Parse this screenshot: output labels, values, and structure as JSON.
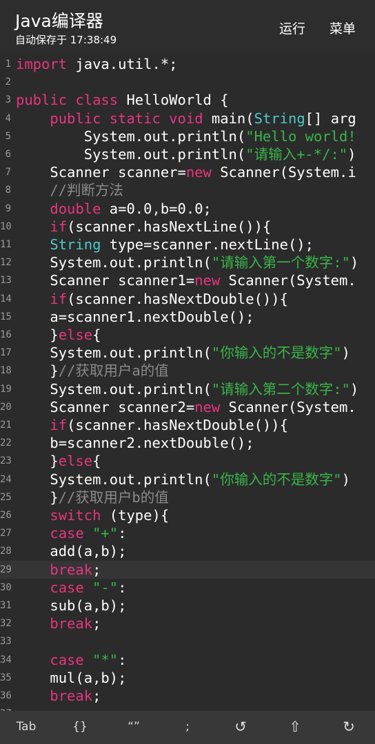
{
  "appbar": {
    "title": "Java编译器",
    "subtitle": "自动保存于 17:38:49",
    "run_label": "运行",
    "menu_label": "菜单"
  },
  "editor": {
    "current_line": 29,
    "colors": {
      "keyword": "#e9357f",
      "type": "#4dc9c9",
      "string": "#39b54a",
      "comment": "#8a8a8a",
      "text": "#ffffff"
    },
    "lines": [
      [
        {
          "t": "import",
          "c": "kw"
        },
        {
          "t": " java.util.*;"
        }
      ],
      [],
      [
        {
          "t": "public class",
          "c": "kw"
        },
        {
          "t": " HelloWorld {"
        }
      ],
      [
        {
          "t": "    "
        },
        {
          "t": "public static void",
          "c": "kw"
        },
        {
          "t": " main("
        },
        {
          "t": "String",
          "c": "ty"
        },
        {
          "t": "[] arg"
        }
      ],
      [
        {
          "t": "        System.out.println("
        },
        {
          "t": "\"Hello world!",
          "c": "st"
        }
      ],
      [
        {
          "t": "        System.out.println("
        },
        {
          "t": "\"请输入+-*/:\"",
          "c": "st"
        },
        {
          "t": ")"
        }
      ],
      [
        {
          "t": "    Scanner scanner="
        },
        {
          "t": "new",
          "c": "kw"
        },
        {
          "t": " Scanner(System.i"
        }
      ],
      [
        {
          "t": "    "
        },
        {
          "t": "//判断方法",
          "c": "cm"
        }
      ],
      [
        {
          "t": "    "
        },
        {
          "t": "double",
          "c": "kw"
        },
        {
          "t": " a=0.0,b=0.0;"
        }
      ],
      [
        {
          "t": "    "
        },
        {
          "t": "if",
          "c": "kw"
        },
        {
          "t": "(scanner.hasNextLine()){"
        }
      ],
      [
        {
          "t": "    "
        },
        {
          "t": "String",
          "c": "ty"
        },
        {
          "t": " type=scanner.nextLine();"
        }
      ],
      [
        {
          "t": "    System.out.println("
        },
        {
          "t": "\"请输入第一个数字:\"",
          "c": "st"
        },
        {
          "t": ")"
        }
      ],
      [
        {
          "t": "    Scanner scanner1="
        },
        {
          "t": "new",
          "c": "kw"
        },
        {
          "t": " Scanner(System."
        }
      ],
      [
        {
          "t": "    "
        },
        {
          "t": "if",
          "c": "kw"
        },
        {
          "t": "(scanner.hasNextDouble()){"
        }
      ],
      [
        {
          "t": "    a=scanner1.nextDouble();"
        }
      ],
      [
        {
          "t": "    }"
        },
        {
          "t": "else",
          "c": "kw"
        },
        {
          "t": "{"
        }
      ],
      [
        {
          "t": "    System.out.println("
        },
        {
          "t": "\"你输入的不是数字\"",
          "c": "st"
        },
        {
          "t": ")"
        }
      ],
      [
        {
          "t": "    }"
        },
        {
          "t": "//获取用户a的值",
          "c": "cm"
        }
      ],
      [
        {
          "t": "    System.out.println("
        },
        {
          "t": "\"请输入第二个数字:\"",
          "c": "st"
        },
        {
          "t": ")"
        }
      ],
      [
        {
          "t": "    Scanner scanner2="
        },
        {
          "t": "new",
          "c": "kw"
        },
        {
          "t": " Scanner(System."
        }
      ],
      [
        {
          "t": "    "
        },
        {
          "t": "if",
          "c": "kw"
        },
        {
          "t": "(scanner.hasNextDouble()){"
        }
      ],
      [
        {
          "t": "    b=scanner2.nextDouble();"
        }
      ],
      [
        {
          "t": "    }"
        },
        {
          "t": "else",
          "c": "kw"
        },
        {
          "t": "{"
        }
      ],
      [
        {
          "t": "    System.out.println("
        },
        {
          "t": "\"你输入的不是数字\"",
          "c": "st"
        },
        {
          "t": ")"
        }
      ],
      [
        {
          "t": "    }"
        },
        {
          "t": "//获取用户b的值",
          "c": "cm"
        }
      ],
      [
        {
          "t": "    "
        },
        {
          "t": "switch",
          "c": "kw"
        },
        {
          "t": " (type){"
        }
      ],
      [
        {
          "t": "    "
        },
        {
          "t": "case",
          "c": "kw"
        },
        {
          "t": " "
        },
        {
          "t": "\"+\"",
          "c": "st"
        },
        {
          "t": ":"
        }
      ],
      [
        {
          "t": "    add(a,b);"
        }
      ],
      [
        {
          "t": "    "
        },
        {
          "t": "break",
          "c": "kw"
        },
        {
          "t": ";"
        }
      ],
      [
        {
          "t": "    "
        },
        {
          "t": "case",
          "c": "kw"
        },
        {
          "t": " "
        },
        {
          "t": "\"-\"",
          "c": "st"
        },
        {
          "t": ":"
        }
      ],
      [
        {
          "t": "    sub(a,b);"
        }
      ],
      [
        {
          "t": "    "
        },
        {
          "t": "break",
          "c": "kw"
        },
        {
          "t": ";"
        }
      ],
      [],
      [
        {
          "t": "    "
        },
        {
          "t": "case",
          "c": "kw"
        },
        {
          "t": " "
        },
        {
          "t": "\"*\"",
          "c": "st"
        },
        {
          "t": ":"
        }
      ],
      [
        {
          "t": "    mul(a,b);"
        }
      ],
      [
        {
          "t": "    "
        },
        {
          "t": "break",
          "c": "kw"
        },
        {
          "t": ";"
        }
      ],
      []
    ]
  },
  "toolbar": {
    "buttons": [
      {
        "name": "tab-key-button",
        "label": "Tab"
      },
      {
        "name": "braces-key-button",
        "label": "{}"
      },
      {
        "name": "quotes-key-button",
        "label": "“”"
      },
      {
        "name": "semicolon-key-button",
        "label": ";"
      },
      {
        "name": "undo-button",
        "label": "↺",
        "icon": "undo-icon"
      },
      {
        "name": "shift-button",
        "label": "⇧",
        "icon": "shift-arrow-icon"
      },
      {
        "name": "redo-button",
        "label": "↻",
        "icon": "redo-icon"
      }
    ]
  }
}
